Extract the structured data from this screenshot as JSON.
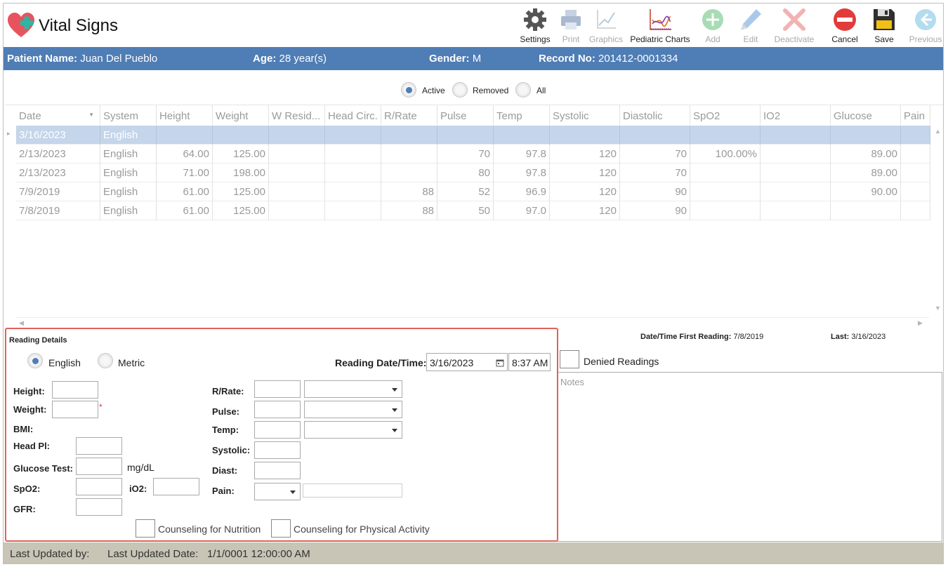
{
  "app": {
    "title": "Vital Signs"
  },
  "toolbar": {
    "items": [
      {
        "label": "Settings",
        "icon": "gear-icon",
        "enabled": true
      },
      {
        "label": "Print",
        "icon": "printer-icon",
        "enabled": false
      },
      {
        "label": "Graphics",
        "icon": "line-chart-icon",
        "enabled": false
      },
      {
        "label": "Pediatric Charts",
        "icon": "pediatric-chart-icon",
        "enabled": true
      },
      {
        "label": "Add",
        "icon": "plus-icon",
        "enabled": false
      },
      {
        "label": "Edit",
        "icon": "pencil-icon",
        "enabled": false
      },
      {
        "label": "Deactivate",
        "icon": "x-icon",
        "enabled": false
      },
      {
        "label": "Cancel",
        "icon": "cancel-icon",
        "enabled": true
      },
      {
        "label": "Save",
        "icon": "floppy-disk-icon",
        "enabled": true
      },
      {
        "label": "Previous",
        "icon": "arrow-left-icon",
        "enabled": false
      }
    ]
  },
  "patient": {
    "name_label": "Patient Name:",
    "name": "Juan Del Pueblo",
    "age_label": "Age:",
    "age": "28 year(s)",
    "gender_label": "Gender:",
    "gender": "M",
    "record_label": "Record No:",
    "record": "201412-0001334"
  },
  "filter": {
    "options": [
      "Active",
      "Removed",
      "All"
    ],
    "selected": "Active"
  },
  "grid": {
    "columns": [
      "Date",
      "System",
      "Height",
      "Weight",
      "W Resid...",
      "Head Circ.",
      "R/Rate",
      "Pulse",
      "Temp",
      "Systolic",
      "Diastolic",
      "SpO2",
      "IO2",
      "Glucose",
      "Pain"
    ],
    "rows": [
      [
        "3/16/2023",
        "English",
        "",
        "",
        "",
        "",
        "",
        "",
        "",
        "",
        "",
        "",
        "",
        "",
        ""
      ],
      [
        "2/13/2023",
        "English",
        "64.00",
        "125.00",
        "",
        "",
        "",
        "70",
        "97.8",
        "120",
        "70",
        "100.00%",
        "",
        "89.00",
        ""
      ],
      [
        "2/13/2023",
        "English",
        "71.00",
        "198.00",
        "",
        "",
        "",
        "80",
        "97.8",
        "120",
        "70",
        "",
        "",
        "89.00",
        ""
      ],
      [
        "7/9/2019",
        "English",
        "61.00",
        "125.00",
        "",
        "",
        "88",
        "52",
        "96.9",
        "120",
        "90",
        "",
        "",
        "90.00",
        ""
      ],
      [
        "7/8/2019",
        "English",
        "61.00",
        "125.00",
        "",
        "",
        "88",
        "50",
        "97.0",
        "120",
        "90",
        "",
        "",
        "",
        ""
      ]
    ],
    "selected_row": 0
  },
  "reading": {
    "title": "Reading Details",
    "unit_options": [
      "English",
      "Metric"
    ],
    "unit_selected": "English",
    "datetime_label": "Reading Date/Time:",
    "date": "3/16/2023",
    "time": "8:37 AM",
    "labels": {
      "height": "Height:",
      "weight": "Weight:",
      "bmi": "BMI:",
      "head_pl": "Head Pl:",
      "glucose": "Glucose Test:",
      "glucose_unit": "mg/dL",
      "spo2": "SpO2:",
      "io2": "iO2:",
      "gfr": "GFR:",
      "rrate": "R/Rate:",
      "pulse": "Pulse:",
      "temp": "Temp:",
      "systolic": "Systolic:",
      "diast": "Diast:",
      "pain": "Pain:"
    },
    "required_mark": "*",
    "counseling_nutrition": "Counseling for Nutrition",
    "counseling_activity": "Counseling for Physical Activity"
  },
  "summary": {
    "first_label": "Date/Time First Reading:",
    "first_value": "7/8/2019",
    "last_label": "Last:",
    "last_value": "3/16/2023",
    "denied_label": "Denied Readings",
    "notes_placeholder": "Notes"
  },
  "footer": {
    "updated_by_label": "Last Updated by:",
    "updated_date_label": "Last Updated Date:",
    "updated_date": "1/1/0001 12:00:00 AM"
  },
  "colors": {
    "accent": "#4f7db5",
    "highlight_border": "#e0625a",
    "selected_row": "#c5d5ea",
    "footer": "#c8c5b7"
  }
}
